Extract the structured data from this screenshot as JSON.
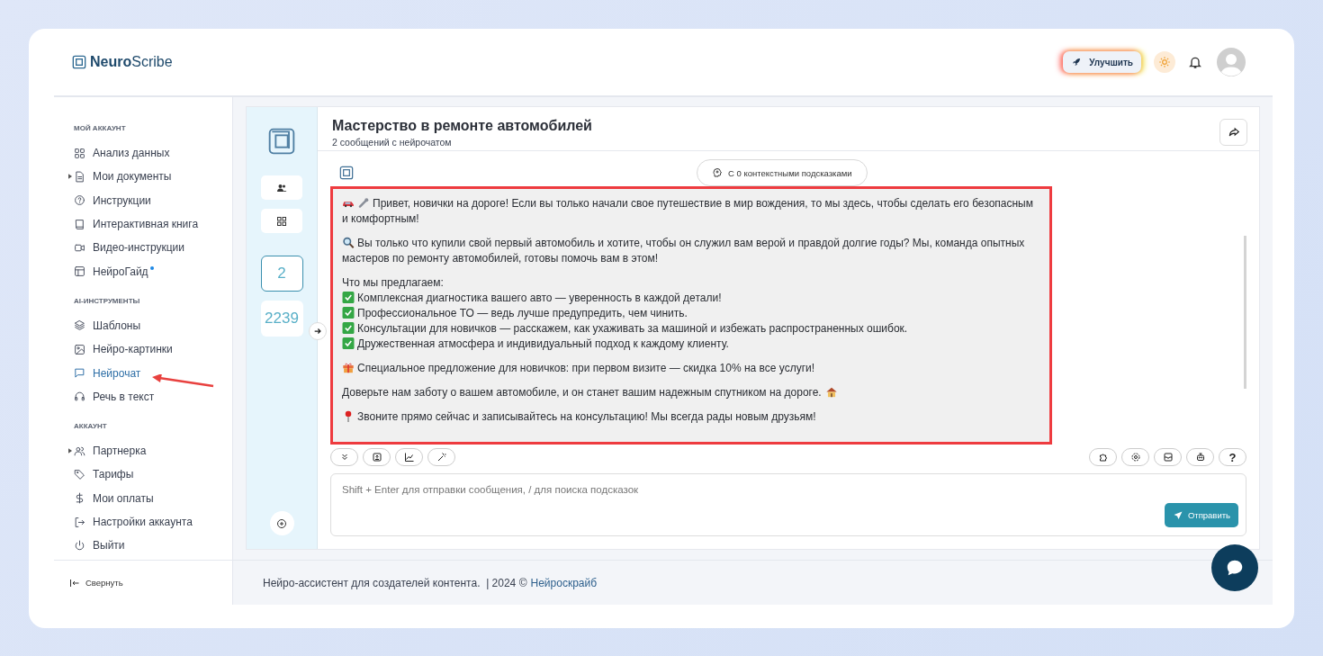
{
  "brand": {
    "bold": "Neuro",
    "rest": "Scribe"
  },
  "header": {
    "upgrade": "Улучшить"
  },
  "sidebar": {
    "sections": [
      {
        "title": "МОЙ АККАУНТ",
        "items": [
          {
            "label": "Анализ данных",
            "selected": false
          },
          {
            "label": "Мои документы",
            "selected": false,
            "expanded": false
          },
          {
            "label": "Инструкции",
            "selected": false
          },
          {
            "label": "Интерактивная книга",
            "selected": false
          },
          {
            "label": "Видео-инструкции",
            "selected": false
          },
          {
            "label": "НейроГайд",
            "selected": false,
            "new": true
          }
        ]
      },
      {
        "title": "AI-ИНСТРУМЕНТЫ",
        "items": [
          {
            "label": "Шаблоны",
            "selected": false
          },
          {
            "label": "Нейро-картинки",
            "selected": false
          },
          {
            "label": "Нейрочат",
            "selected": true
          },
          {
            "label": "Речь в текст",
            "selected": false
          }
        ]
      },
      {
        "title": "АККАУНТ",
        "items": [
          {
            "label": "Партнерка",
            "selected": false,
            "expanded": false
          },
          {
            "label": "Тарифы",
            "selected": false
          },
          {
            "label": "Мои оплаты",
            "selected": false
          },
          {
            "label": "Настройки аккаунта",
            "selected": false
          },
          {
            "label": "Выйти",
            "selected": false
          }
        ]
      }
    ],
    "collapse": "Свернуть"
  },
  "rail": {
    "counters": [
      {
        "value": "2",
        "selected": true
      },
      {
        "value": "2239",
        "selected": false
      }
    ]
  },
  "chat": {
    "title": "Мастерство в ремонте автомобилей",
    "subtitle": "2 сообщений с нейрочатом",
    "hints": "С 0 контекстными подсказками",
    "message": [
      {
        "kind": "car",
        "text": "Привет, новички на дороге! Если вы только начали свое путешествие в мир вождения, то мы здесь, чтобы сделать его безопасным и комфортным!"
      },
      {
        "kind": "search",
        "text": "Вы только что купили свой первый автомобиль и хотите, чтобы он служил вам верой и правдой долгие годы? Мы, команда опытных мастеров по ремонту автомобилей, готовы помочь вам в этом!"
      },
      {
        "kind": "heading",
        "text": "Что мы предлагаем:"
      },
      {
        "kind": "check",
        "text": "Комплексная диагностика вашего авто — уверенность в каждой детали!"
      },
      {
        "kind": "check",
        "text": "Профессиональное ТО — ведь лучше предупредить, чем чинить."
      },
      {
        "kind": "check",
        "text": "Консультации для новичков — расскажем, как ухаживать за машиной и избежать распространенных ошибок."
      },
      {
        "kind": "check",
        "text": "Дружественная атмосфера и индивидуальный подход к каждому клиенту."
      },
      {
        "kind": "gift",
        "text": "Специальное предложение для новичков: при первом визите — скидка 10% на все услуги!"
      },
      {
        "kind": "house",
        "text": "Доверьте нам заботу о вашем автомобиле, и он станет вашим надежным спутником на дороге."
      },
      {
        "kind": "pin",
        "text": "Звоните прямо сейчас и записывайтесь на консультацию! Мы всегда рады новым друзьям!"
      }
    ],
    "placeholder": "Shift + Enter для отправки сообщения, / для поиска подсказок",
    "send": "Отправить",
    "help": "?"
  },
  "footer": {
    "text": "Нейро-ассистент для создателей контента.  | 2024 ©",
    "link": "Нейроскрайб"
  }
}
